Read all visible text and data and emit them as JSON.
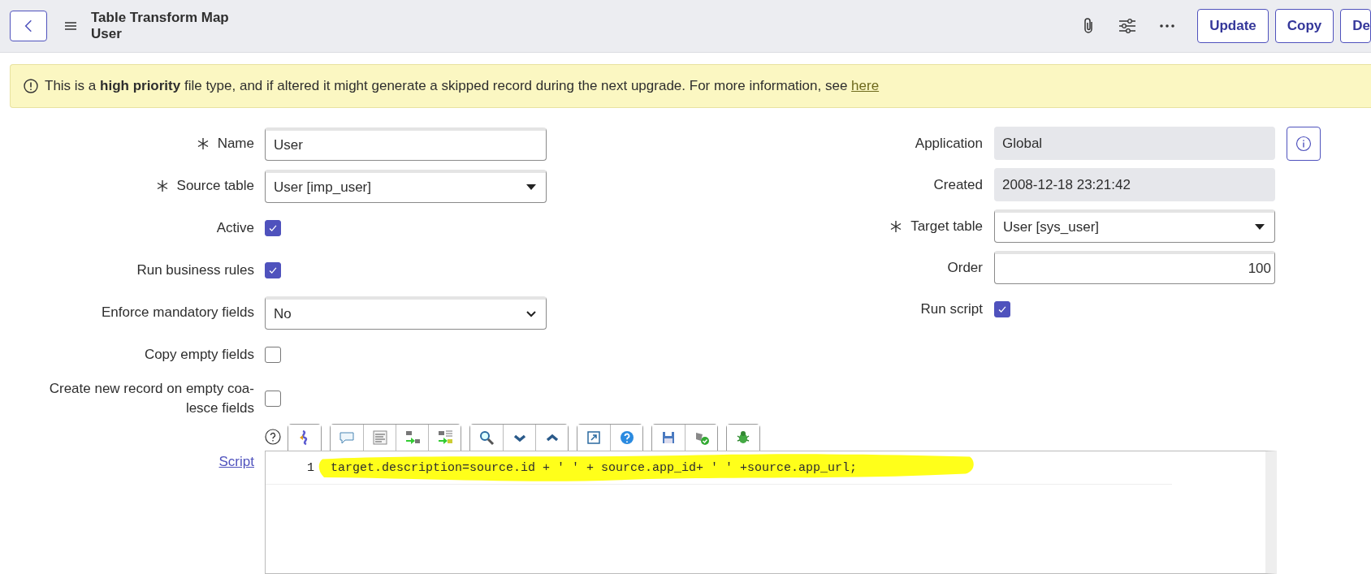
{
  "header": {
    "title": "Table Transform Map",
    "subtitle": "User",
    "buttons": [
      "Update",
      "Copy",
      "De"
    ]
  },
  "banner": {
    "text": "This is a **high priority** file type, and if altered it might generate a skipped record during the next upgrade. For more information, see ",
    "link": "here"
  },
  "left_fields": [
    {
      "kind": "text",
      "label": "Name",
      "required": true,
      "value": "User"
    },
    {
      "kind": "reference",
      "label": "Source table",
      "required": true,
      "value": "User [imp_user]"
    },
    {
      "kind": "checkbox",
      "label": "Active",
      "required": false,
      "checked": true
    },
    {
      "kind": "checkbox",
      "label": "Run business rules",
      "required": false,
      "checked": true
    },
    {
      "kind": "select",
      "label": "Enforce mandatory fields",
      "required": false,
      "value": "No"
    },
    {
      "kind": "checkbox",
      "label": "Copy empty fields",
      "required": false,
      "checked": false
    },
    {
      "kind": "checkbox",
      "label": "Create new record on empty coa-\nlesce fields",
      "required": false,
      "checked": false
    }
  ],
  "right_fields": [
    {
      "kind": "readonly",
      "label": "Application",
      "required": false,
      "value": "Global",
      "info_button": true
    },
    {
      "kind": "readonly",
      "label": "Created",
      "required": false,
      "value": "2008-12-18 23:21:42",
      "info_button": false
    },
    {
      "kind": "reference",
      "label": "Target table",
      "required": true,
      "value": "User [sys_user]",
      "info_button": false
    },
    {
      "kind": "number",
      "label": "Order",
      "required": false,
      "value": "100",
      "info_button": false
    },
    {
      "kind": "checkbox",
      "label": "Run script",
      "required": false,
      "checked": true,
      "info_button": false
    }
  ],
  "script": {
    "label": "Script",
    "lines": [
      {
        "number": "1",
        "code": "target.description=source.id + ' ' + source.app_id+ ' ' +source.app_url;",
        "highlighted": true
      }
    ]
  }
}
